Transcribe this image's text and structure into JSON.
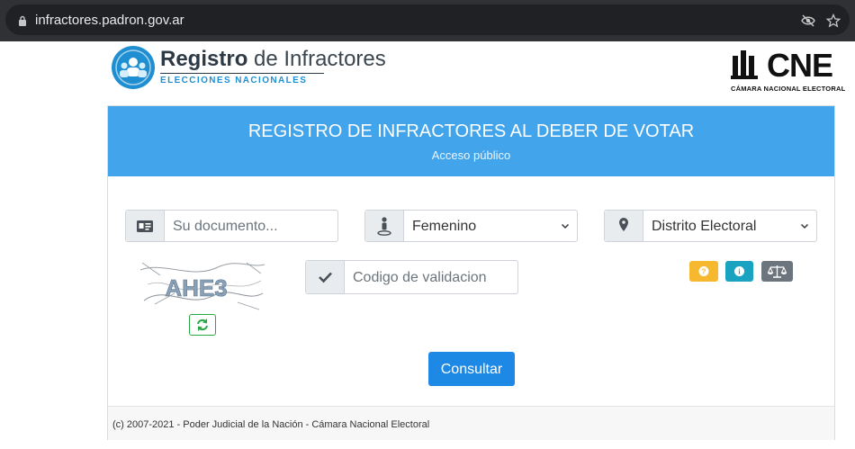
{
  "browser": {
    "url": "infractores.padron.gov.ar",
    "icons": [
      "lock-icon",
      "eye-off-icon",
      "star-icon"
    ]
  },
  "header": {
    "logo_title_bold": "Registro",
    "logo_title_rest": " de Infractores",
    "logo_subtitle": "ELECCIONES NACIONALES",
    "cne_text": "CNE",
    "cne_subtitle": "CÁMARA NACIONAL ELECTORAL"
  },
  "card": {
    "title": "REGISTRO DE INFRACTORES AL DEBER DE VOTAR",
    "subtitle": "Acceso público",
    "header_color": "#42a5ec"
  },
  "form": {
    "document_placeholder": "Su documento...",
    "gender_value": "Femenino",
    "district_value": "Distrito Electoral",
    "captcha_text": "AHE3",
    "validation_placeholder": "Codigo de validacion",
    "submit_label": "Consultar",
    "button_colors": {
      "help": "#f5b82e",
      "info": "#1aa3c1",
      "legal": "#6c757d",
      "primary": "#1e88e5"
    }
  },
  "footer": {
    "text": "(c) 2007-2021 - Poder Judicial de la Nación - Cámara Nacional Electoral"
  }
}
